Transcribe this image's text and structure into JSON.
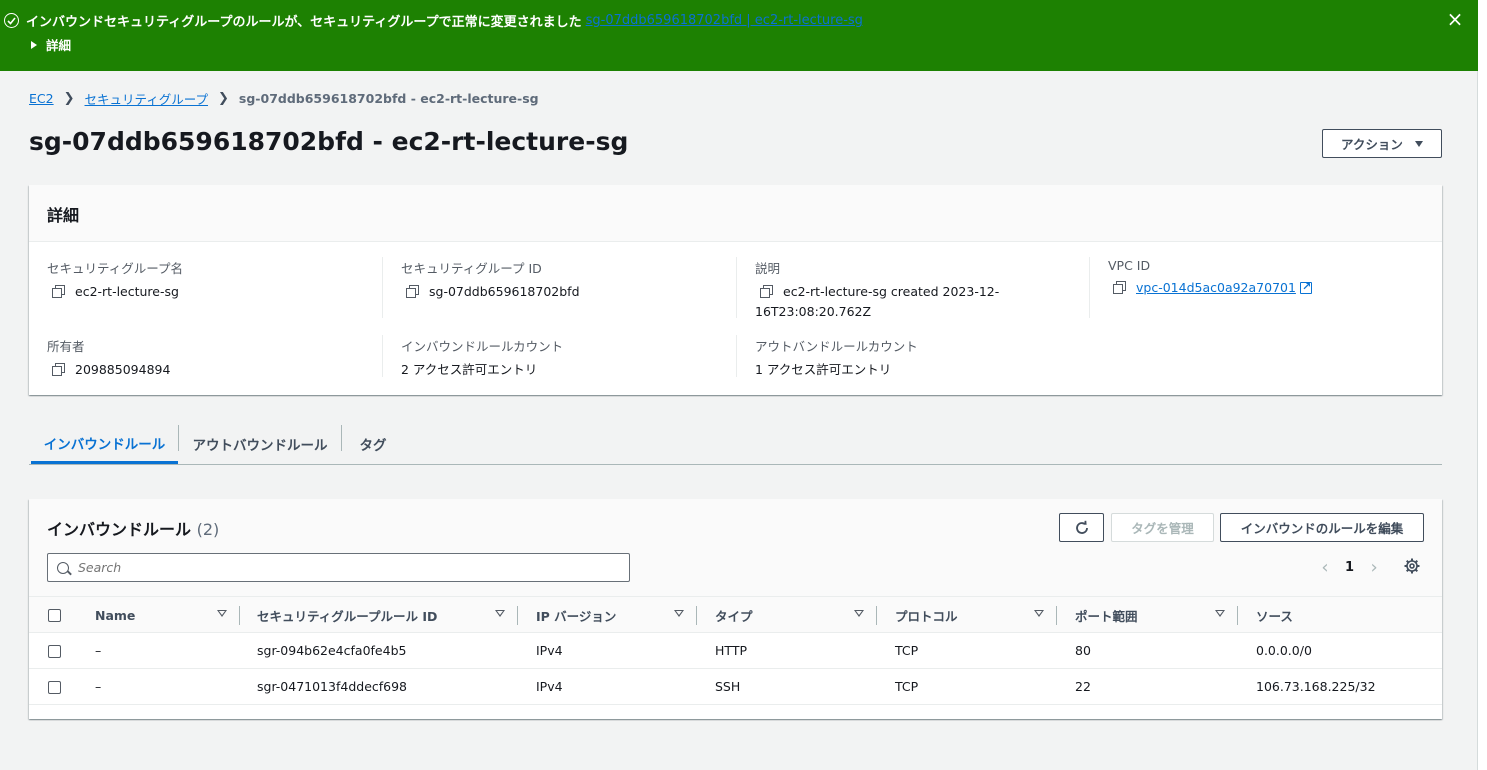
{
  "flash": {
    "message": "インバウンドセキュリティグループのルールが、セキュリティグループで正常に変更されました",
    "link": "sg-07ddb659618702bfd | ec2-rt-lecture-sg",
    "detail": "詳細",
    "color": "#1d8102"
  },
  "breadcrumb": {
    "root": "EC2",
    "section": "セキュリティグループ",
    "current": "sg-07ddb659618702bfd - ec2-rt-lecture-sg"
  },
  "page": {
    "title": "sg-07ddb659618702bfd - ec2-rt-lecture-sg",
    "actions_label": "アクション"
  },
  "details": {
    "heading": "詳細",
    "sg_name_label": "セキュリティグループ名",
    "sg_name": "ec2-rt-lecture-sg",
    "sg_id_label": "セキュリティグループ ID",
    "sg_id": "sg-07ddb659618702bfd",
    "desc_label": "説明",
    "desc_line1": "ec2-rt-lecture-sg created 2023-12-",
    "desc_line2": "16T23:08:20.762Z",
    "vpc_label": "VPC ID",
    "vpc_id": "vpc-014d5ac0a92a70701",
    "owner_label": "所有者",
    "owner": "209885094894",
    "inbound_count_label": "インバウンドルールカウント",
    "inbound_count": "2 アクセス許可エントリ",
    "outbound_count_label": "アウトバンドルールカウント",
    "outbound_count": "1 アクセス許可エントリ"
  },
  "tabs": [
    "インバウンドルール",
    "アウトバウンドルール",
    "タグ"
  ],
  "rules": {
    "title": "インバウンドルール",
    "count": "(2)",
    "manage_tags_label": "タグを管理",
    "edit_label": "インバウンドのルールを編集",
    "search_placeholder": "Search",
    "page": "1",
    "columns": [
      "Name",
      "セキュリティグループルール ID",
      "IP バージョン",
      "タイプ",
      "プロトコル",
      "ポート範囲",
      "ソース"
    ],
    "rows": [
      [
        "–",
        "sgr-094b62e4cfa0fe4b5",
        "IPv4",
        "HTTP",
        "TCP",
        "80",
        "0.0.0.0/0"
      ],
      [
        "–",
        "sgr-0471013f4ddecf698",
        "IPv4",
        "SSH",
        "TCP",
        "22",
        "106.73.168.225/32"
      ]
    ]
  }
}
